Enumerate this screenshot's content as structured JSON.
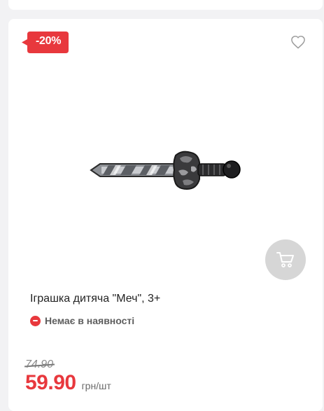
{
  "product": {
    "discount_badge": "-20%",
    "title": "Іграшка дитяча \"Меч\", 3+",
    "stock_status": "Немає в наявності",
    "old_price": "74.90",
    "price": "59.90",
    "price_unit": "грн/шт"
  },
  "icons": {
    "wishlist": "heart-icon",
    "cart": "cart-icon",
    "stock": "minus-circle-icon"
  },
  "colors": {
    "accent": "#e8383d",
    "cart_button_bg": "#d6d6d6",
    "page_bg": "#f2f2f4"
  }
}
